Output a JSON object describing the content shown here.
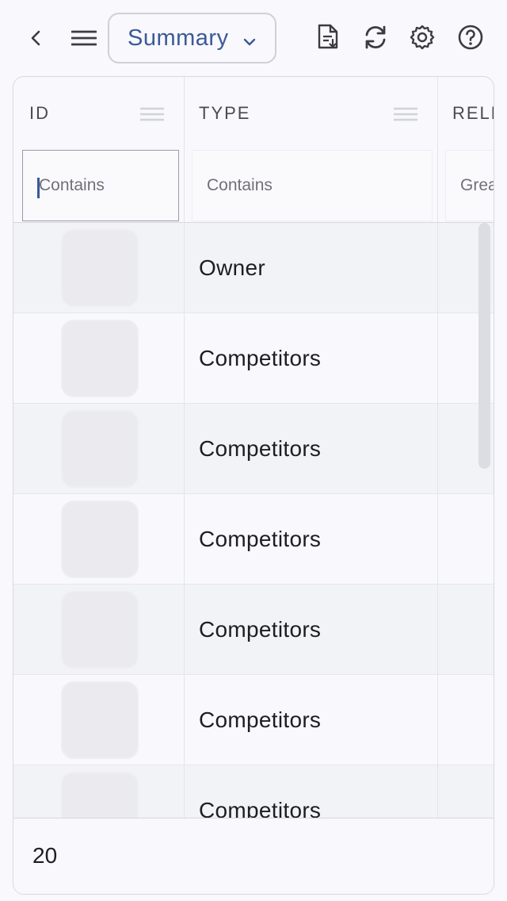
{
  "toolbar": {
    "view_select_value": "Summary",
    "icons": [
      "back-icon",
      "menu-icon",
      "export-document-icon",
      "refresh-icon",
      "settings-icon",
      "help-icon"
    ]
  },
  "grid": {
    "columns": [
      {
        "header": "ID",
        "filter_placeholder": "Contains"
      },
      {
        "header": "TYPE",
        "filter_placeholder": "Contains"
      },
      {
        "header": "RELE",
        "filter_placeholder": "Grea"
      }
    ],
    "rows": [
      {
        "type": "Owner"
      },
      {
        "type": "Competitors"
      },
      {
        "type": "Competitors"
      },
      {
        "type": "Competitors"
      },
      {
        "type": "Competitors"
      },
      {
        "type": "Competitors"
      },
      {
        "type": "Competitors"
      }
    ],
    "footer": {
      "count": "20"
    }
  },
  "colors": {
    "accent": "#3a5a98",
    "row_alt": "#f2f3f7",
    "background": "#f8f8fd"
  }
}
